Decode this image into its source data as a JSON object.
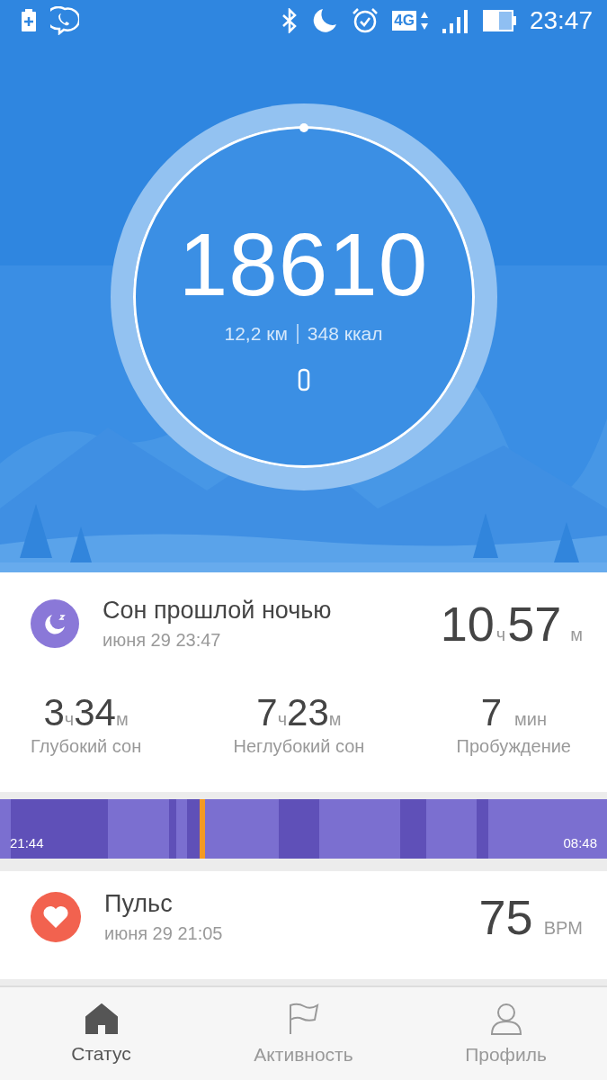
{
  "status_bar": {
    "time": "23:47",
    "network": "4G"
  },
  "steps": {
    "count": "18610",
    "distance": "12,2 км",
    "calories": "348 ккал"
  },
  "sleep": {
    "title": "Сон прошлой ночью",
    "date": "июня 29 23:47",
    "hours": "10",
    "hours_unit": "ч",
    "minutes": "57",
    "minutes_unit": "м",
    "stats": [
      {
        "kind": "hm",
        "h": "3",
        "hu": "ч",
        "m": "34",
        "mu": "м",
        "label": "Глубокий сон"
      },
      {
        "kind": "hm",
        "h": "7",
        "hu": "ч",
        "m": "23",
        "mu": "м",
        "label": "Неглубокий сон"
      },
      {
        "kind": "min",
        "m": "7",
        "mu": "мин",
        "label": "Пробуждение"
      }
    ],
    "start": "21:44",
    "end": "08:48"
  },
  "pulse": {
    "title": "Пульс",
    "date": "июня 29 21:05",
    "value": "75",
    "unit": "BPM"
  },
  "nav": [
    {
      "label": "Статус",
      "kind": "home",
      "selected": true
    },
    {
      "label": "Активность",
      "kind": "flag",
      "selected": false
    },
    {
      "label": "Профиль",
      "kind": "person",
      "selected": false
    }
  ]
}
